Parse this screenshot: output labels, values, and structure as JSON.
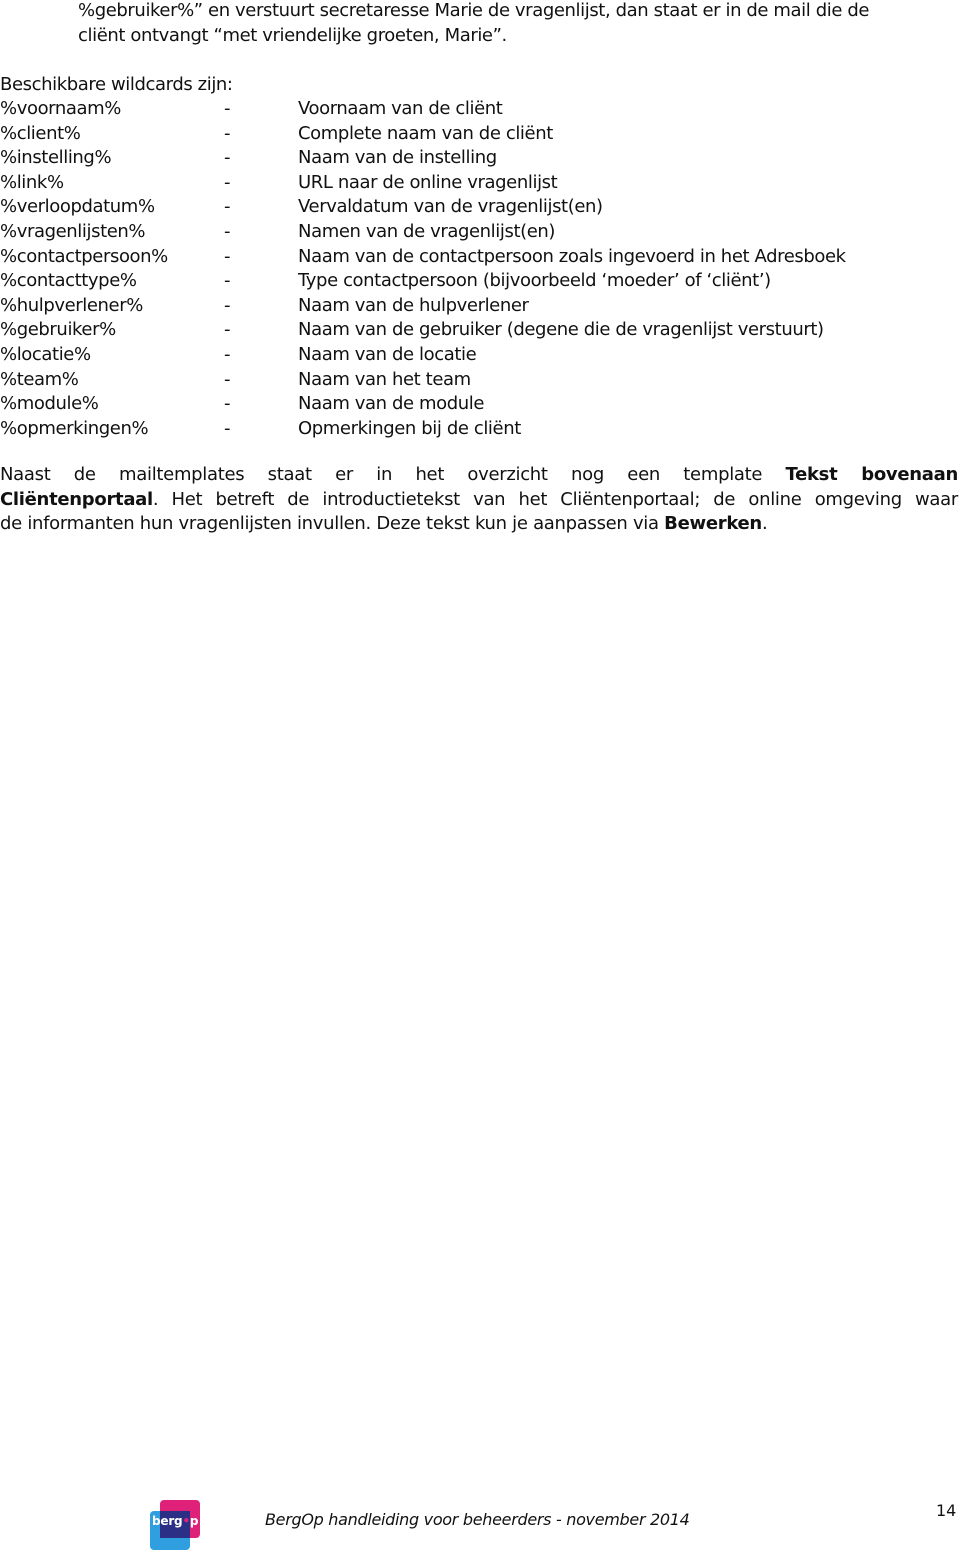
{
  "intro": {
    "line1": "%gebruiker%” en verstuurt secretaresse Marie de vragenlijst, dan staat er in de mail die de",
    "line2": "cliënt ontvangt “met vriendelijke groeten, Marie”."
  },
  "wildcards": {
    "heading": "Beschikbare wildcards zijn:",
    "separator": "-",
    "items": [
      {
        "name": "%voornaam%",
        "description": "Voornaam van de cliënt"
      },
      {
        "name": "%client%",
        "description": "Complete naam van de cliënt"
      },
      {
        "name": "%instelling%",
        "description": "Naam van de instelling"
      },
      {
        "name": "%link%",
        "description": "URL naar de online vragenlijst"
      },
      {
        "name": "%verloopdatum%",
        "description": "Vervaldatum van de vragenlijst(en)"
      },
      {
        "name": "%vragenlijsten%",
        "description": "Namen van de vragenlijst(en)"
      },
      {
        "name": "%contactpersoon%",
        "description": "Naam van de contactpersoon zoals ingevoerd in het Adresboek"
      },
      {
        "name": "%contacttype%",
        "description": "Type contactpersoon (bijvoorbeeld ‘moeder’ of ‘cliënt’)"
      },
      {
        "name": "%hulpverlener%",
        "description": "Naam van de hulpverlener"
      },
      {
        "name": "%gebruiker%",
        "description": "Naam van de gebruiker (degene die de vragenlijst verstuurt)"
      },
      {
        "name": "%locatie%",
        "description": "Naam van de locatie"
      },
      {
        "name": "%team%",
        "description": "Naam van het team"
      },
      {
        "name": "%module%",
        "description": "Naam van de module"
      },
      {
        "name": "%opmerkingen%",
        "description": "Opmerkingen bij de cliënt"
      }
    ]
  },
  "paragraph": {
    "part1": "Naast de mailtemplates staat er in het overzicht nog een template ",
    "bold1a": "Tekst bovenaan",
    "bold1b": "Cliëntenportaal",
    "part2": ". Het betreft de introductietekst van het Cliëntenportaal; de online omgeving waar",
    "part3": "de informanten hun vragenlijsten invullen. Deze tekst kun je aanpassen via ",
    "bold2": "Bewerken",
    "part4": "."
  },
  "footer": {
    "logo_text_before": "berg",
    "logo_dot": "•",
    "logo_text_after": "p",
    "text": "BergOp handleiding voor beheerders -  november 2014",
    "page_number": "14"
  },
  "colors": {
    "logo_pink": "#e0217a",
    "logo_blue": "#2f9fe0",
    "logo_navy": "#2b2f86"
  }
}
